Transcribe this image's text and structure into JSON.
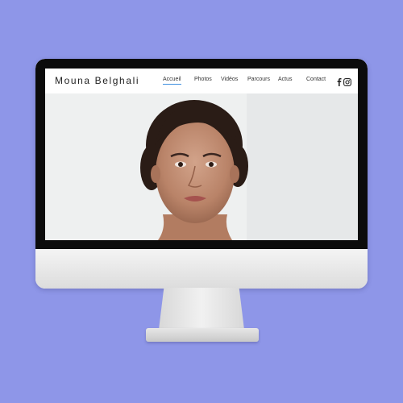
{
  "site": {
    "brand": "Mouna Belghali",
    "nav": [
      {
        "label": "Accueil",
        "active": true
      },
      {
        "label": "Photos",
        "active": false
      },
      {
        "label": "Vidéos",
        "active": false
      },
      {
        "label": "Parcours",
        "active": false
      },
      {
        "label": "Actus",
        "active": false
      },
      {
        "label": "Contact",
        "active": false
      }
    ],
    "social_icons": [
      "facebook-icon",
      "instagram-icon"
    ],
    "accent_color": "#3f8fe0"
  },
  "scene": {
    "background_color": "#8e96e8",
    "device": "desktop-monitor"
  }
}
